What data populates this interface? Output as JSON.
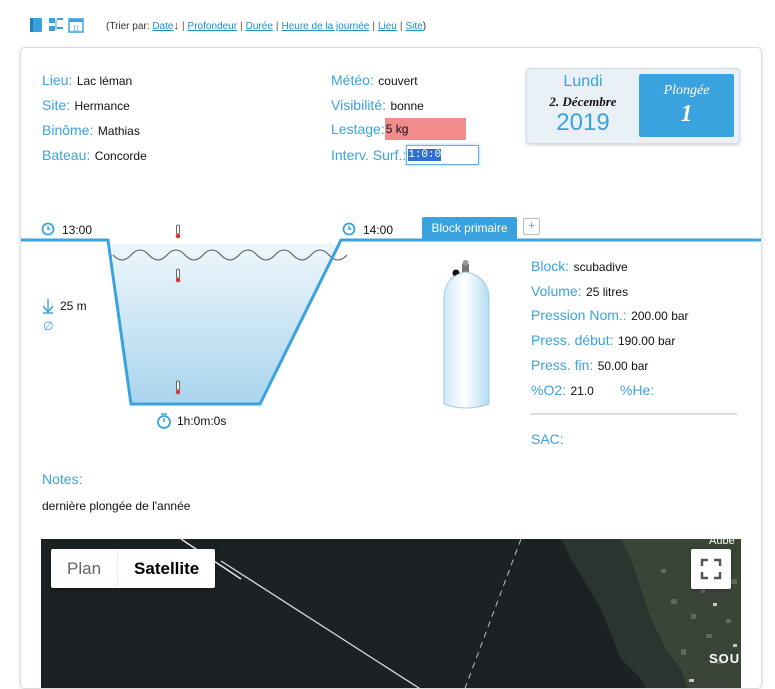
{
  "sort": {
    "prefix": "(Trier par:",
    "options": [
      "Date",
      "Profondeur",
      "Durée",
      "Heure de la journée",
      "Lieu",
      "Site"
    ],
    "arrow": "↓",
    "suffix": ")"
  },
  "toolbar": {
    "icons": [
      "book-icon",
      "list-toggle-icon",
      "calendar-icon"
    ],
    "calendar_day": "11"
  },
  "dive": {
    "left_fields": [
      {
        "label": "Lieu:",
        "value": "Lac léman"
      },
      {
        "label": "Site:",
        "value": "Hermance"
      },
      {
        "label": "Binôme:",
        "value": "Mathias"
      },
      {
        "label": "Bateau:",
        "value": "Concorde"
      }
    ],
    "meteo": {
      "label": "Météo:",
      "value": "couvert"
    },
    "visibilite": {
      "label": "Visibilité:",
      "value": "bonne"
    },
    "lestage": {
      "label": "Lestage:",
      "value": "5 kg"
    },
    "interv": {
      "label": "Interv. Surf.:",
      "value": "1:0:0"
    }
  },
  "date": {
    "day": "Lundi",
    "date": "2. Décembre",
    "year": "2019",
    "plongee_label": "Plongée",
    "plongee_number": "1"
  },
  "profile": {
    "start_time": "13:00",
    "end_time": "14:00",
    "depth": "25 m",
    "depth_extra": "∅",
    "duration": "1h:0m:0s"
  },
  "tank": {
    "tab_label": "Block primaire",
    "plus": "+",
    "fields": [
      {
        "label": "Block:",
        "value": "scubadive"
      },
      {
        "label": "Volume:",
        "value": "25 litres"
      },
      {
        "label": "Pression Nom.:",
        "value": "200.00 bar"
      },
      {
        "label": "Press. début:",
        "value": "190.00 bar"
      },
      {
        "label": "Press. fin:",
        "value": "50.00 bar"
      }
    ],
    "o2_label": "%O2:",
    "o2_value": "21.0",
    "he_label": "%He:",
    "sac_label": "SAC:"
  },
  "notes": {
    "label": "Notes:",
    "text": "dernière plongée de l'année"
  },
  "map": {
    "plan_label": "Plan",
    "satellite_label": "Satellite",
    "labels": [
      "Aube",
      "SOU"
    ]
  },
  "colors": {
    "accent": "#3aa3df",
    "lestage_bg": "#f28b8b"
  }
}
